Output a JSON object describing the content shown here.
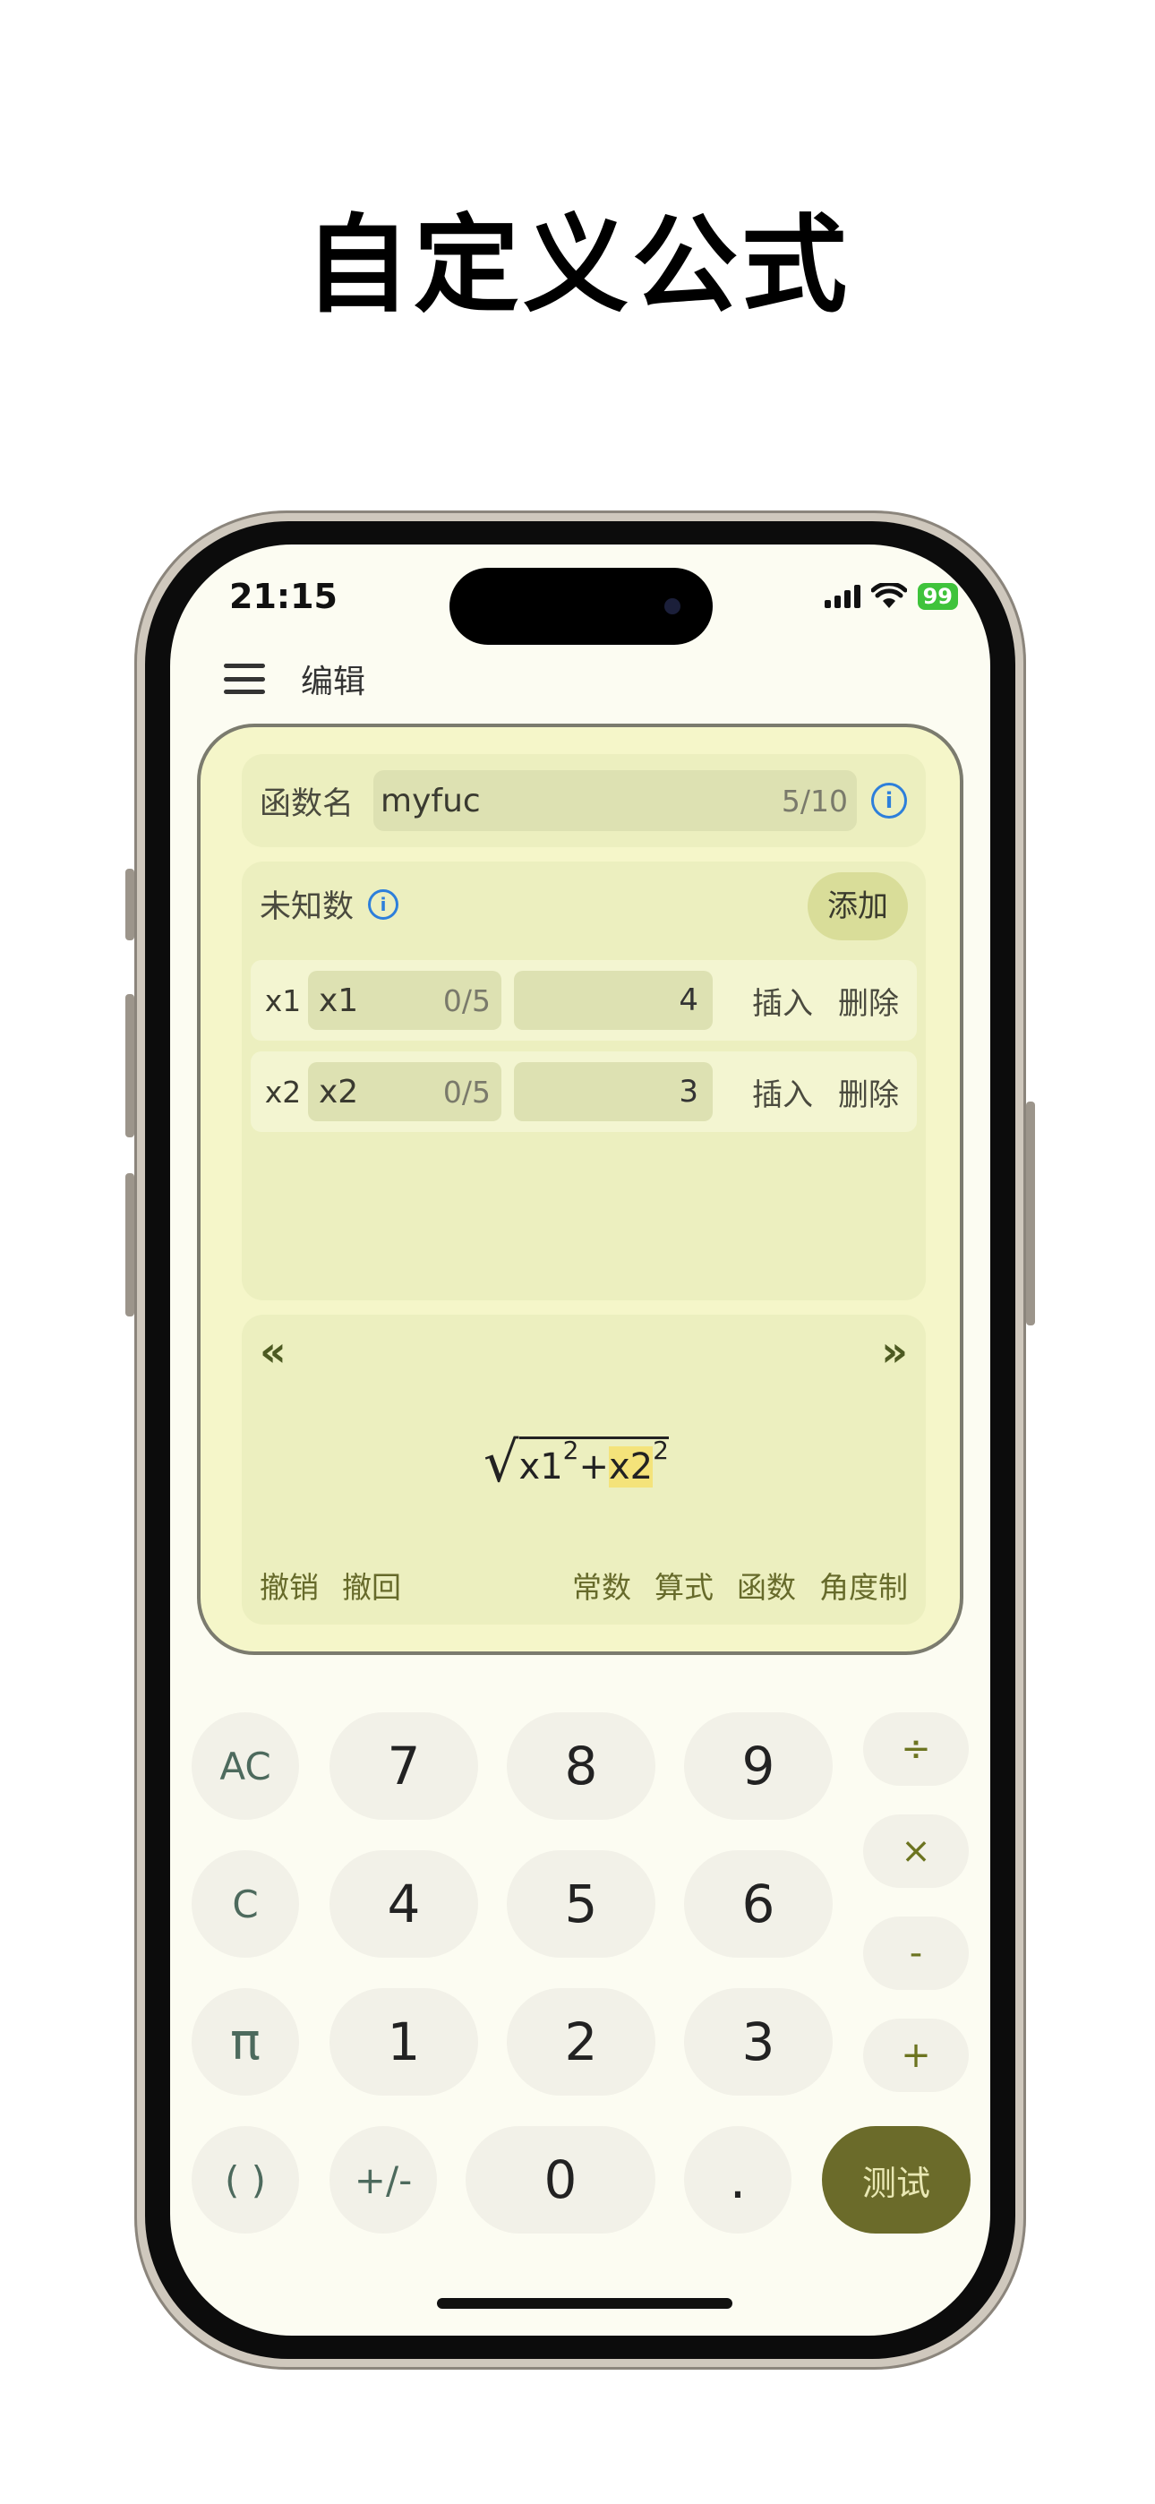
{
  "hero": {
    "title": "自定义公式"
  },
  "status": {
    "time": "21:15",
    "battery": "99",
    "icons": [
      "signal-icon",
      "wifi-icon",
      "battery-icon"
    ]
  },
  "appbar": {
    "title": "编辑",
    "menu_icon": "menu-icon"
  },
  "function_name": {
    "label": "函数名",
    "value": "myfuc",
    "counter": "5/10",
    "info_icon": "info-icon"
  },
  "variables": {
    "label": "未知数",
    "add_label": "添加",
    "rows": [
      {
        "index": "x1",
        "name": "x1",
        "counter": "0/5",
        "value": "4",
        "insert": "插入",
        "delete": "删除"
      },
      {
        "index": "x2",
        "name": "x2",
        "counter": "0/5",
        "value": "3",
        "insert": "插入",
        "delete": "删除"
      }
    ]
  },
  "formula": {
    "left_nav": "«",
    "right_nav": "»",
    "term1": "x1",
    "exp1": "2",
    "plus": "+",
    "term2": "x2",
    "exp2": "2",
    "tools_left": [
      "撤销",
      "撤回"
    ],
    "tools_right": [
      "常数",
      "算式",
      "函数",
      "角度制"
    ]
  },
  "keypad": {
    "ac": "AC",
    "c": "C",
    "pi": "π",
    "paren": "( )",
    "sign": "+/-",
    "k7": "7",
    "k8": "8",
    "k9": "9",
    "k4": "4",
    "k5": "5",
    "k6": "6",
    "k1": "1",
    "k2": "2",
    "k3": "3",
    "k0": "0",
    "dot": ".",
    "divide": "÷",
    "multiply": "×",
    "minus": "-",
    "plus": "+",
    "test": "测试"
  },
  "colors": {
    "card": "#f5f6c9",
    "panel": "#ecefbf",
    "accent": "#6b6b2a",
    "info": "#2d7fdb"
  }
}
